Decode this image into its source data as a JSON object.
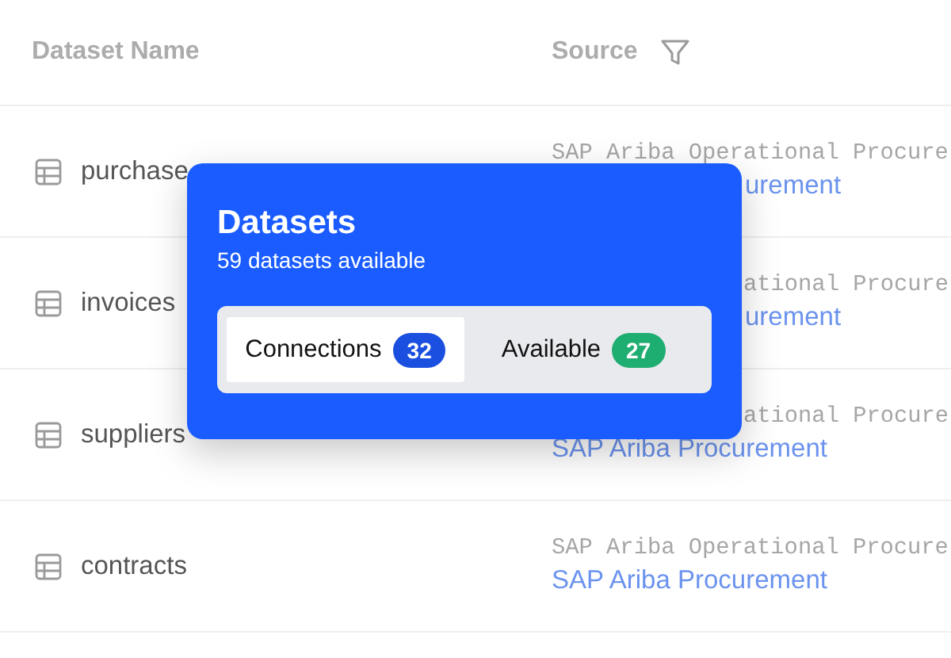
{
  "table": {
    "columns": [
      {
        "label": "Dataset Name",
        "filter": false
      },
      {
        "label": "Source",
        "filter": true
      }
    ],
    "rows": [
      {
        "name": "purchase",
        "source": [
          {
            "text": "SAP Ariba Operational Procure",
            "kind": "system",
            "covered": false
          },
          {
            "text": "urement",
            "kind": "link",
            "covered": true
          }
        ]
      },
      {
        "name": "invoices",
        "source": [
          {
            "text": "ational Procure",
            "kind": "system",
            "covered": true
          },
          {
            "text": "urement",
            "kind": "link",
            "covered": true
          }
        ]
      },
      {
        "name": "suppliers",
        "source": [
          {
            "text": "ational Procure",
            "kind": "system",
            "covered": true
          },
          {
            "text": "SAP Ariba Procurement",
            "kind": "link",
            "covered": false
          }
        ]
      },
      {
        "name": "contracts",
        "source": [
          {
            "text": "SAP Ariba Operational Procure",
            "kind": "system",
            "covered": false
          },
          {
            "text": "SAP Ariba Procurement",
            "kind": "link",
            "covered": false
          }
        ]
      }
    ]
  },
  "popover": {
    "title": "Datasets",
    "subtitle": "59 datasets available",
    "tabs": [
      {
        "label": "Connections",
        "count": "32",
        "color": "#1a4fe0",
        "selected": true
      },
      {
        "label": "Available",
        "count": "27",
        "color": "#1fae72",
        "selected": false
      }
    ]
  }
}
